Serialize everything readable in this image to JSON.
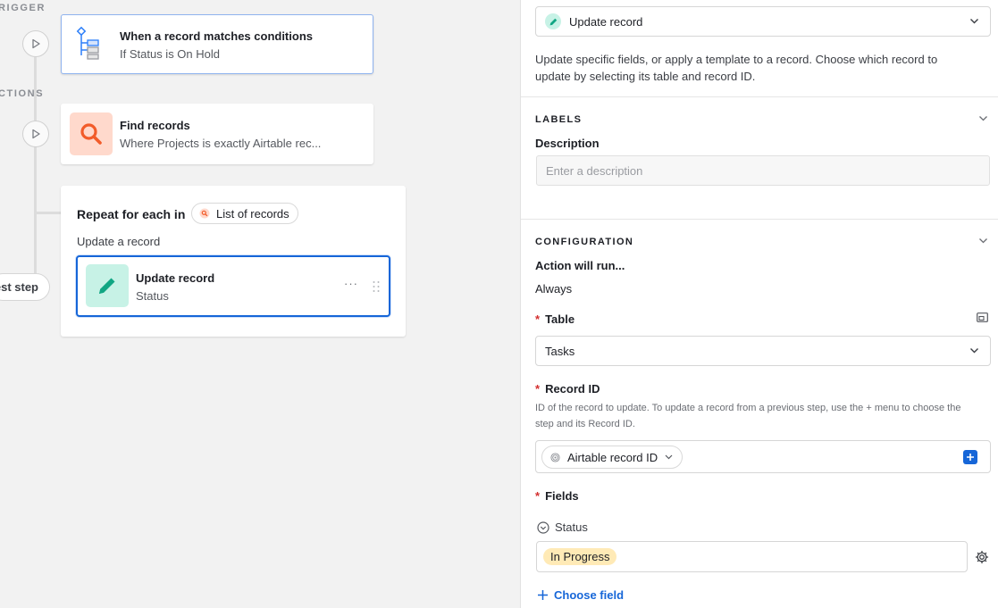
{
  "canvas": {
    "trigger_label": "RIGGER",
    "actions_label": "CTIONS",
    "trigger_card": {
      "title": "When a record matches conditions",
      "subtitle": "If Status is On Hold"
    },
    "find_card": {
      "title": "Find records",
      "subtitle": "Where Projects is exactly Airtable rec..."
    },
    "repeat_group": {
      "prefix": "Repeat for each in",
      "chip_label": "List of records",
      "caption": "Update a record"
    },
    "update_card": {
      "title": "Update record",
      "subtitle": "Status",
      "more_label": "···"
    },
    "test_step_label": "est step"
  },
  "panel": {
    "action_select": {
      "value": "Update record"
    },
    "description": "Update specific fields, or apply a template to a record. Choose which record to update by selecting its table and record ID.",
    "labels_section": {
      "heading": "LABELS",
      "description_label": "Description",
      "description_placeholder": "Enter a description"
    },
    "config_section": {
      "heading": "CONFIGURATION",
      "run_label": "Action will run...",
      "run_value": "Always",
      "table_label": "Table",
      "table_value": "Tasks",
      "record_id_label": "Record ID",
      "record_id_hint": "ID of the record to update. To update a record from a previous step, use the + menu to choose the step and its Record ID.",
      "record_id_chip": "Airtable record ID",
      "fields_label": "Fields",
      "status_field_label": "Status",
      "status_value": "In Progress",
      "choose_field_label": "Choose field",
      "required_marker": "*"
    }
  },
  "colors": {
    "accent_blue": "#1666d8",
    "update_icon_bg": "#c7f2e6",
    "update_icon_fg": "#11a683",
    "find_icon_bg": "#ffd9cc",
    "find_icon_fg": "#f25c2a",
    "status_pill": "#ffeab6"
  }
}
